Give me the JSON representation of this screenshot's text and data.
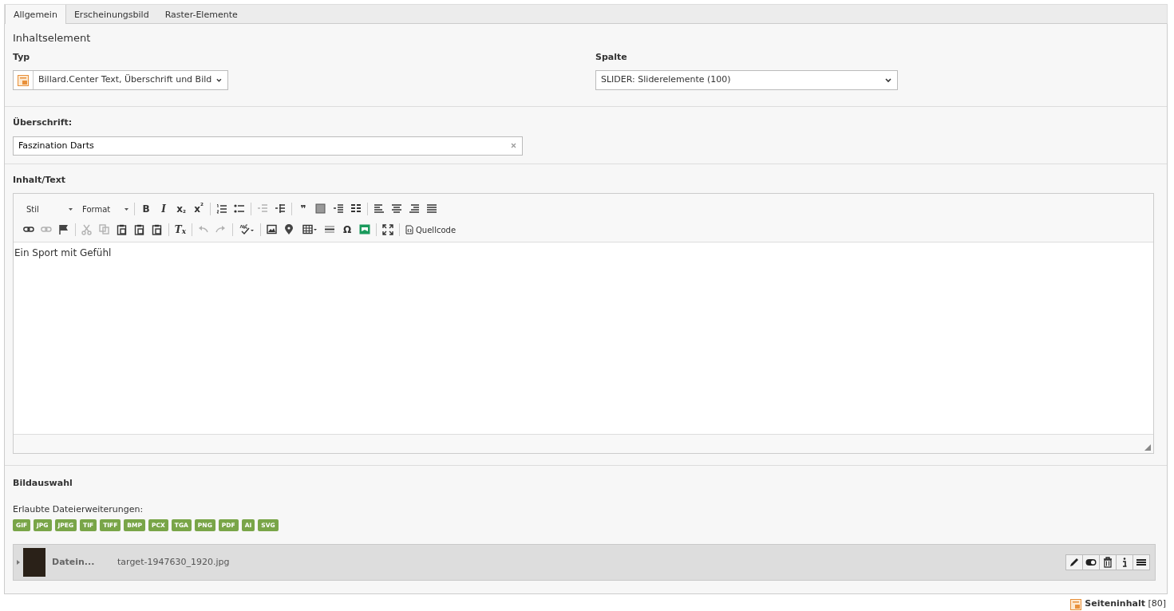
{
  "tabs": [
    {
      "label": "Allgemein",
      "selected": true
    },
    {
      "label": "Erscheinungsbild",
      "selected": false
    },
    {
      "label": "Raster-Elemente",
      "selected": false
    }
  ],
  "section_title": "Inhaltselement",
  "type_field": {
    "label": "Typ",
    "value": "Billard.Center Text, Überschrift und Bild"
  },
  "column_field": {
    "label": "Spalte",
    "value": "SLIDER: Sliderelemente (100)"
  },
  "header_field": {
    "label": "Überschrift:",
    "value": "Faszination Darts"
  },
  "bodytext": {
    "label": "Inhalt/Text",
    "content": "Ein Sport mit Gefühl",
    "toolbar_rows": [
      [
        {
          "kind": "combo",
          "label": "Stil"
        },
        {
          "kind": "combo",
          "label": "Format"
        },
        {
          "kind": "sep"
        },
        {
          "kind": "glyph",
          "label": "B"
        },
        {
          "kind": "glyph",
          "label": "I"
        },
        {
          "kind": "glyph",
          "label": "x$_{₂}$"
        },
        {
          "kind": "glyph",
          "label": "x$^{²}$"
        },
        {
          "kind": "sep"
        },
        {
          "kind": "icon",
          "disabled": false
        },
        {
          "kind": "icon",
          "disabled": false
        },
        {
          "kind": "sep"
        },
        {
          "kind": "icon",
          "disabled": true
        },
        {
          "kind": "icon",
          "disabled": false
        },
        {
          "kind": "sep"
        },
        {
          "kind": "glyph",
          "label": "❞"
        },
        {
          "kind": "icon",
          "disabled": false
        },
        {
          "kind": "icon",
          "disabled": false
        },
        {
          "kind": "icon",
          "disabled": false
        },
        {
          "kind": "sep"
        },
        {
          "kind": "icon",
          "disabled": false
        },
        {
          "kind": "icon",
          "disabled": false
        },
        {
          "kind": "icon",
          "disabled": false
        },
        {
          "kind": "icon",
          "disabled": false
        }
      ],
      [
        {
          "kind": "icon",
          "disabled": false
        },
        {
          "kind": "icon",
          "disabled": true
        },
        {
          "kind": "icon",
          "disabled": false
        },
        {
          "kind": "sep"
        },
        {
          "kind": "icon",
          "disabled": true
        },
        {
          "kind": "icon",
          "disabled": true
        },
        {
          "kind": "icon",
          "disabled": false
        },
        {
          "kind": "icon",
          "disabled": false
        },
        {
          "kind": "icon",
          "disabled": false
        },
        {
          "kind": "sep"
        },
        {
          "kind": "glyph",
          "label": "T$_{x}$"
        },
        {
          "kind": "sep"
        },
        {
          "kind": "icon",
          "disabled": true
        },
        {
          "kind": "icon",
          "disabled": true
        },
        {
          "kind": "sep"
        },
        {
          "kind": "icon",
          "disabled": false
        },
        {
          "kind": "sep"
        },
        {
          "kind": "icon",
          "disabled": false
        },
        {
          "kind": "icon",
          "disabled": false
        },
        {
          "kind": "icon",
          "disabled": false
        },
        {
          "kind": "icon",
          "disabled": false
        },
        {
          "kind": "glyph",
          "label": "Ω"
        },
        {
          "kind": "icon",
          "disabled": false
        },
        {
          "kind": "sep"
        },
        {
          "kind": "icon",
          "disabled": false
        },
        {
          "kind": "sep"
        },
        {
          "kind": "source",
          "label": "Quellcode"
        }
      ]
    ]
  },
  "image_field": {
    "label": "Bildauswahl",
    "allowed_label": "Erlaubte Dateierweiterungen:",
    "extensions": [
      "GIF",
      "JPG",
      "JPEG",
      "TIF",
      "TIFF",
      "BMP",
      "PCX",
      "TGA",
      "PNG",
      "PDF",
      "AI",
      "SVG"
    ],
    "file": {
      "title": "Datein...",
      "filename": "target-1947630_1920.jpg",
      "expanded": false
    }
  },
  "footer": {
    "record_type": "Seiteninhalt",
    "record_id": "[80]"
  }
}
